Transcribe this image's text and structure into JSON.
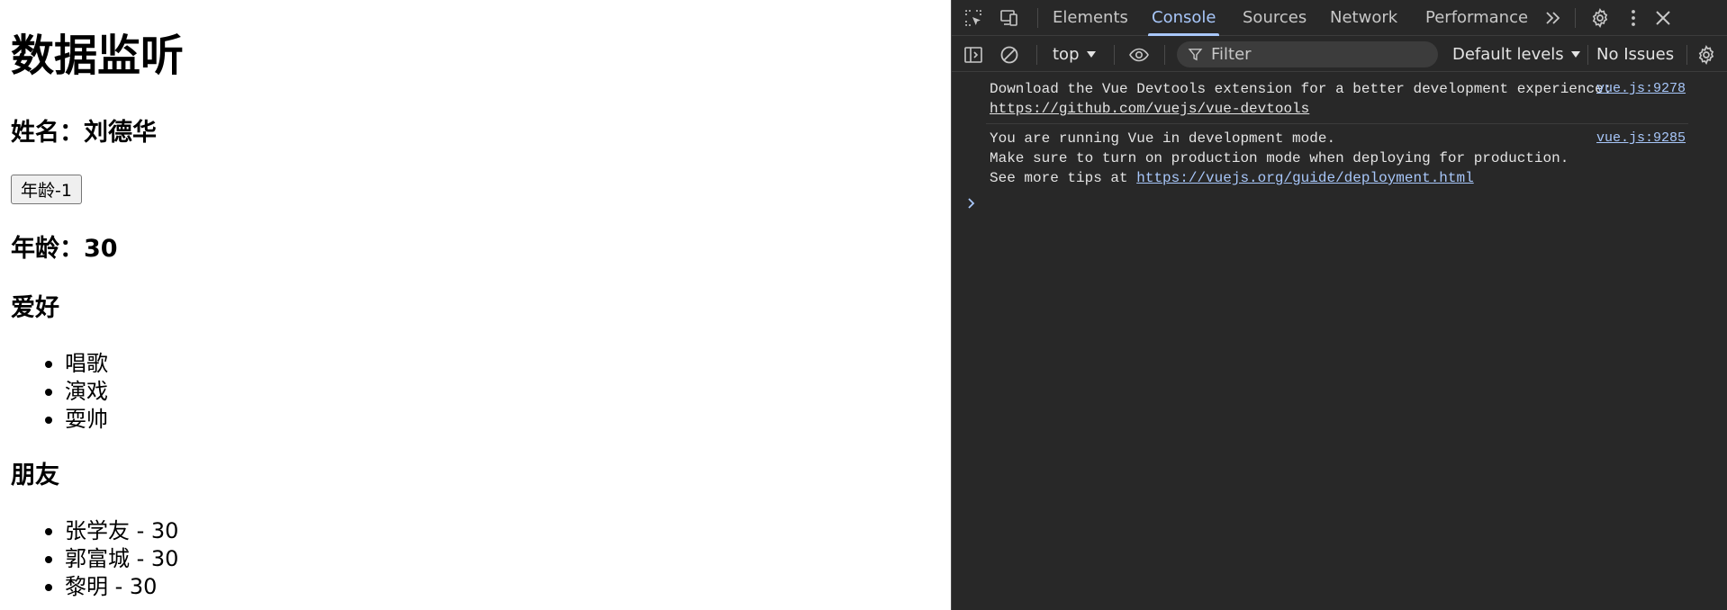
{
  "page": {
    "title": "数据监听",
    "name_label": "姓名：刘德华",
    "age_button_label": "年龄-1",
    "age_label": "年龄：30",
    "hobby_heading": "爱好",
    "hobbies": [
      "唱歌",
      "演戏",
      "耍帅"
    ],
    "friends_heading": "朋友",
    "friends": [
      "张学友 - 30",
      "郭富城 - 30",
      "黎明 - 30"
    ]
  },
  "devtools": {
    "tabs": [
      "Elements",
      "Console",
      "Sources",
      "Network",
      "Performance"
    ],
    "active_tab": "Console",
    "more_tabs_icon": "chevron-double-right-icon",
    "toolbar": {
      "context": "top",
      "filter_placeholder": "Filter",
      "levels": "Default levels",
      "issues": "No Issues"
    },
    "messages": [
      {
        "source": "vue.js:9278",
        "lines": [
          "Download the Vue Devtools extension for a better development experience:",
          "https://github.com/vuejs/vue-devtools"
        ]
      },
      {
        "source": "vue.js:9285",
        "lines": [
          "You are running Vue in development mode.",
          "Make sure to turn on production mode when deploying for production.",
          "See more tips at ",
          "https://vuejs.org/guide/deployment.html"
        ]
      }
    ],
    "accent_color": "#a8c7fa",
    "background_color": "#282828"
  }
}
